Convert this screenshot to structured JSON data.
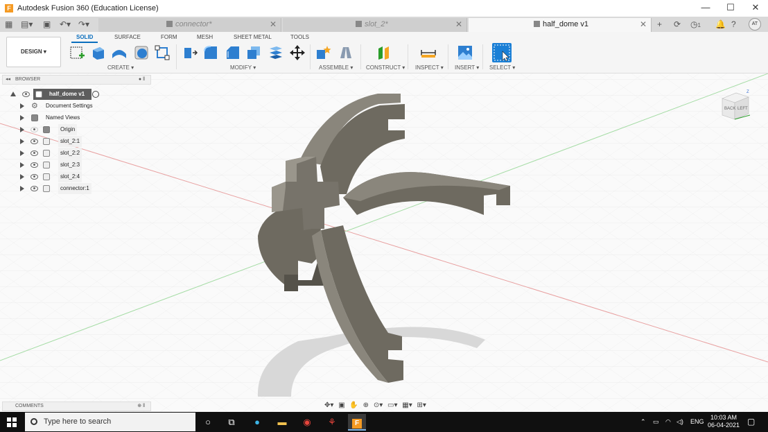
{
  "window": {
    "title": "Autodesk Fusion 360 (Education License)",
    "logo_letter": "F",
    "minimize": "—",
    "maximize": "☐",
    "close": "✕"
  },
  "tabs": [
    {
      "label": "connector*",
      "active": false
    },
    {
      "label": "slot_2*",
      "active": false
    },
    {
      "label": "half_dome v1",
      "active": true
    }
  ],
  "header_right": {
    "add_tab": "+",
    "job_count": "1",
    "avatar": "AT"
  },
  "toolbar": {
    "workspace": "DESIGN ▾",
    "ribbon_tabs": [
      "SOLID",
      "SURFACE",
      "FORM",
      "MESH",
      "SHEET METAL",
      "TOOLS"
    ],
    "groups": [
      "CREATE ▾",
      "MODIFY ▾",
      "ASSEMBLE ▾",
      "CONSTRUCT ▾",
      "INSPECT ▾",
      "INSERT ▾",
      "SELECT ▾"
    ]
  },
  "browser": {
    "title": "BROWSER",
    "root": "half_dome v1",
    "items": [
      "Document Settings",
      "Named Views",
      "Origin",
      "slot_2:1",
      "slot_2:2",
      "slot_2:3",
      "slot_2:4",
      "connector:1"
    ]
  },
  "comments": {
    "title": "COMMENTS"
  },
  "viewcube": {
    "front": "BACK",
    "side": "LEFT",
    "top_axis": "Z"
  },
  "taskbar": {
    "search_placeholder": "Type here to search",
    "language": "ENG",
    "time": "10:03 AM",
    "date": "06-04-2021"
  },
  "colors": {
    "accent": "#0a6ebd",
    "model_face": "#6e6a60",
    "model_side": "#8a867c",
    "grid": "#e4e4e4",
    "x_axis": "#e88a8a",
    "y_axis": "#8fd08f"
  }
}
